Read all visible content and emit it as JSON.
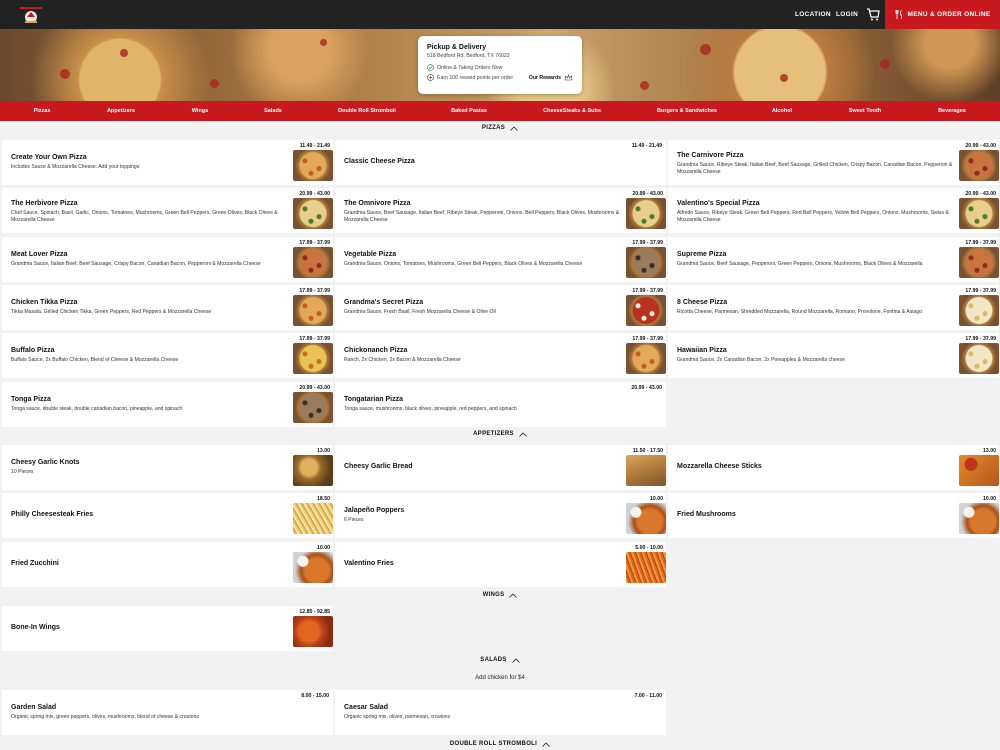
{
  "colors": {
    "brand_red": "#c8191e",
    "topbar": "#222222",
    "page_bg": "#f2f2f2"
  },
  "nav": {
    "location": "LOCATION",
    "login": "LOGIN",
    "cart_icon": "cart-icon",
    "order_label": "MENU & ORDER ONLINE",
    "order_icon": "fork-knife-icon"
  },
  "info_card": {
    "title": "Pickup & Delivery",
    "address": "518 Bedford Rd, Bedford, TX 76022",
    "status": "Online & Taking Orders Now",
    "points": "Earn 100 reward points per order",
    "rewards": "Our Rewards"
  },
  "categories": [
    "Pizzas",
    "Appetizers",
    "Wings",
    "Salads",
    "Double Roll Stromboli",
    "Baked Pastas",
    "CheeseSteaks & Subs",
    "Burgers & Sandwiches",
    "Alcohol",
    "Sweet Tooth",
    "Beverages"
  ],
  "sections": {
    "pizzas": {
      "title": "PIZZAS",
      "items": [
        {
          "name": "Create Your Own Pizza",
          "desc": "Includes Sauce & Mozzarella Cheese. Add your toppings",
          "price": "11.49 - 21.49",
          "img": "pizza-plain"
        },
        {
          "name": "Classic Cheese Pizza",
          "desc": "",
          "price": "11.49 - 21.49",
          "img": ""
        },
        {
          "name": "The Carnivore Pizza",
          "desc": "Grandma Sauce, Ribeye Steak, Italian Beef, Beef Sausage, Grilled Chicken, Crispy Bacon, Canadian Bacon, Pepperoni & Mozzarella Cheese",
          "price": "20.99 - 43.00",
          "img": "pizza-meat"
        },
        {
          "name": "The Herbivore Pizza",
          "desc": "Chef Sauce, Spinach, Basil, Garlic, Onions, Tomatoes, Mushrooms, Green Bell Peppers, Green Olives, Black Olives & Mozzarella Cheese",
          "price": "20.99 - 43.00",
          "img": "pizza-veg"
        },
        {
          "name": "The Omnivore Pizza",
          "desc": "Grandma Sauce, Beef Sausage, Italian Beef, Ribeye Steak, Pepperoni, Onions, Bell Peppers, Black Olives, Mushrooms & Mozzarella Cheese",
          "price": "20.99 - 43.00",
          "img": "pizza-veg"
        },
        {
          "name": "Valentino's Special Pizza",
          "desc": "Alfredo Sauce, Ribeye Steak, Green Bell Peppers, Red Bell Peppers, Yellow Bell Peppers, Onions, Mushrooms, Swiss & Mozzarella Cheese",
          "price": "20.99 - 43.00",
          "img": "pizza-veg"
        },
        {
          "name": "Meat Lover Pizza",
          "desc": "Grandma Sauce, Italian Beef, Beef Sausage, Crispy Bacon, Canadian Bacon, Pepperoni & Mozzarella Cheese",
          "price": "17.99 - 37.99",
          "img": "pizza-meat"
        },
        {
          "name": "Vegetable Pizza",
          "desc": "Grandma Sauce, Onions, Tomatoes, Mushrooms, Green Bell Peppers, Black Olives & Mozzarella Cheese",
          "price": "17.99 - 37.99",
          "img": "pizza-dark"
        },
        {
          "name": "Supreme Pizza",
          "desc": "Grandma Sauce, Beef Sausage, Pepperoni, Green Peppers, Onions, Mushrooms, Black Olives & Mozzarella",
          "price": "17.99 - 37.99",
          "img": "pizza-meat"
        },
        {
          "name": "Chicken Tikka Pizza",
          "desc": "Tikka Masala, Grilled Chicken Tikka, Green Peppers, Red Peppers & Mozzarella Cheese",
          "price": "17.99 - 37.99",
          "img": "pizza-plain"
        },
        {
          "name": "Grandma's Secret Pizza",
          "desc": "Grandma Sauce, Fresh Basil, Fresh Mozzarella Cheese & Olive Oil",
          "price": "17.99 - 37.99",
          "img": "pizza-red"
        },
        {
          "name": "8 Cheese Pizza",
          "desc": "Ricotta Cheese, Parmesan, Shredded Mozzarella, Round Mozzarella, Romano, Provolone, Fontina & Asiago",
          "price": "17.99 - 37.99",
          "img": "pizza-white"
        },
        {
          "name": "Buffalo Pizza",
          "desc": "Buffalo Sauce, 2x Buffalo Chicken, Blend of Cheese & Mozzarella Cheese",
          "price": "17.99 - 37.99",
          "img": "pizza-yellow"
        },
        {
          "name": "Chickonanch Pizza",
          "desc": "Ranch, 2x Chicken, 2x Bacon & Mozzarella Cheese",
          "price": "17.99 - 37.99",
          "img": "pizza-plain"
        },
        {
          "name": "Hawaiian Pizza",
          "desc": "Grandma Sauce, 2x Canadian Bacon, 2x Pineapples & Mozzarella cheese",
          "price": "17.99 - 37.99",
          "img": "pizza-white"
        },
        {
          "name": "Tonga Pizza",
          "desc": "Tonga sauce, double steak, double canadian bacon, pineapple, and spinach",
          "price": "20.99 - 43.00",
          "img": "pizza-dark"
        },
        {
          "name": "Tongatarian Pizza",
          "desc": "Tonga sauce, mushrooms, black olives, pineapple, red peppers, and spinach",
          "price": "20.99 - 43.00",
          "img": ""
        }
      ]
    },
    "appetizers": {
      "title": "APPETIZERS",
      "items": [
        {
          "name": "Cheesy Garlic Knots",
          "desc": "10 Pieces",
          "price": "13.00",
          "img": "knots"
        },
        {
          "name": "Cheesy Garlic Bread",
          "desc": "",
          "price": "11.50 - 17.50",
          "img": "bread"
        },
        {
          "name": "Mozzarella Cheese Sticks",
          "desc": "",
          "price": "13.00",
          "img": "sticks"
        },
        {
          "name": "Philly Cheesesteak Fries",
          "desc": "",
          "price": "18.50",
          "img": "fries"
        },
        {
          "name": "Jalapeño Poppers",
          "desc": "6 Pieces",
          "price": "10.00",
          "img": "wings"
        },
        {
          "name": "Fried Mushrooms",
          "desc": "",
          "price": "10.00",
          "img": "wings"
        },
        {
          "name": "Fried Zucchini",
          "desc": "",
          "price": "10.00",
          "img": "wings"
        },
        {
          "name": "Valentino Fries",
          "desc": "",
          "price": "5.00 - 10.00",
          "img": "fries2"
        }
      ]
    },
    "wings": {
      "title": "WINGS",
      "items": [
        {
          "name": "Bone-In Wings",
          "desc": "",
          "price": "12.85 - 92.85",
          "img": "hotwings"
        }
      ]
    },
    "salads": {
      "title": "SALADS",
      "note": "Add chicken for $4",
      "items": [
        {
          "name": "Garden Salad",
          "desc": "Organic spring mix, green peppers, olives, mushrooms, blend of cheese & croutons",
          "price": "8.00 - 15.00",
          "img": ""
        },
        {
          "name": "Caesar Salad",
          "desc": "Organic spring mix, olives, parmesan, croutons",
          "price": "7.00 - 11.00",
          "img": ""
        }
      ]
    },
    "stromboli": {
      "title": "DOUBLE ROLL STROMBOLI"
    }
  }
}
